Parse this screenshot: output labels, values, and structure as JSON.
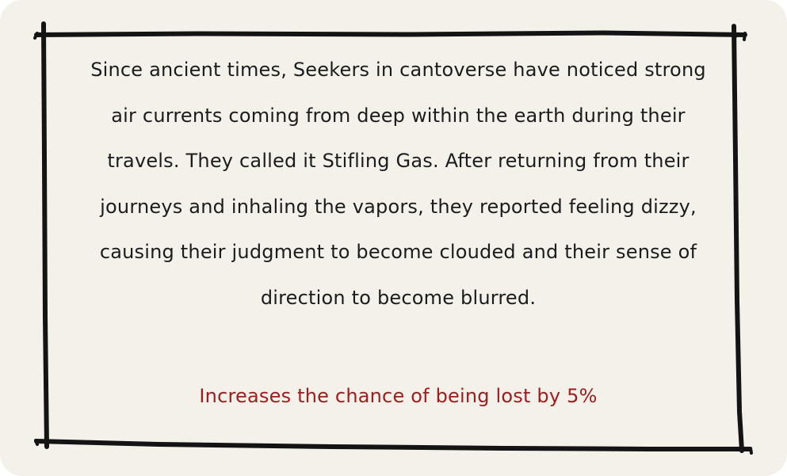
{
  "card": {
    "description": "Since ancient times, Seekers in cantoverse have noticed strong air currents coming from deep within the earth during their travels. They called it Stifling Gas. After returning from their journeys and inhaling the vapors, they reported feeling dizzy, causing their judgment to become clouded and their sense of direction to become blurred.",
    "effect": "Increases the chance of being lost by 5%"
  },
  "colors": {
    "background": "#f3f1ea",
    "frame": "#141414",
    "text": "#1c1c1c",
    "effect": "#a11d1d"
  }
}
